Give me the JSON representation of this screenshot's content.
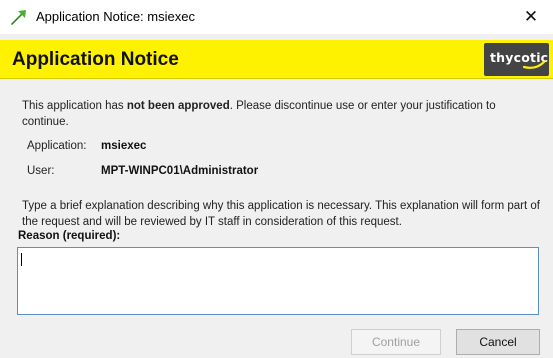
{
  "window": {
    "title": "Application Notice: msiexec",
    "close_glyph": "✕"
  },
  "banner": {
    "title": "Application Notice",
    "logo_text": "thycotic",
    "color": "#fff200"
  },
  "message": {
    "part1": "This application has ",
    "bold": "not been approved",
    "part2": ". Please discontinue use or enter your justification to continue."
  },
  "details": {
    "application_label": "Application:",
    "application_value": "msiexec",
    "user_label": "User:",
    "user_value": "MPT-WINPC01\\Administrator"
  },
  "explanation": "Type a brief explanation describing why this application is necessary. This explanation will form part of the request and will be reviewed by IT staff in consideration of this request.",
  "reason": {
    "label": "Reason (required):",
    "value": ""
  },
  "buttons": {
    "continue_label": "Continue",
    "cancel_label": "Cancel"
  },
  "icons": {
    "app": "green-arrow-icon",
    "close": "close-icon"
  }
}
